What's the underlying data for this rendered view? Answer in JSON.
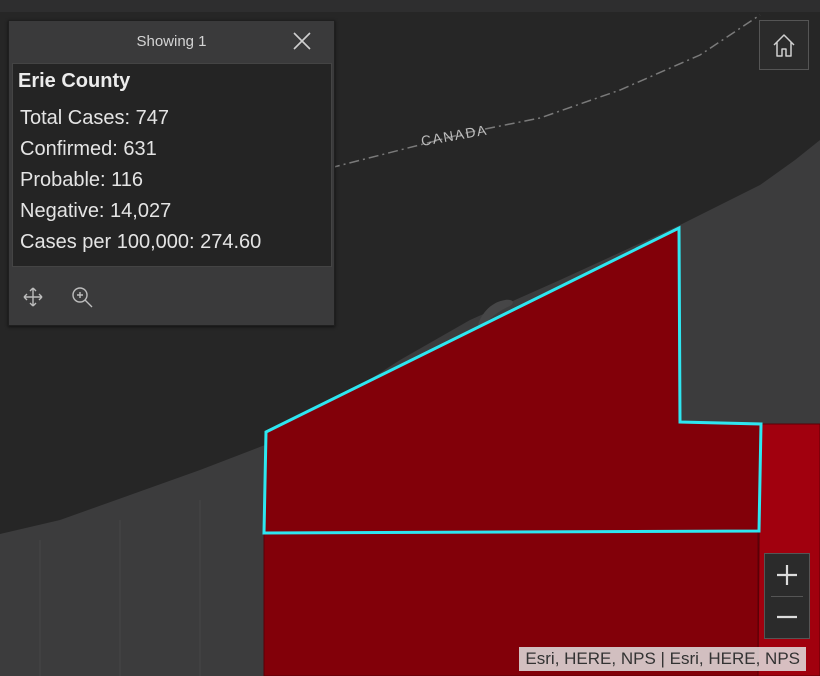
{
  "map": {
    "label_country": "CANADA",
    "colors": {
      "water": "#262626",
      "land": "#3c3c3d",
      "county_fill": "#820009",
      "county_bright": "#a1000e",
      "selection": "#2ee6f0"
    }
  },
  "popup": {
    "feature_count_label": "Showing 1",
    "title": "Erie County",
    "lines": [
      "Total Cases: 747",
      "Confirmed: 631",
      "Probable: 116",
      "Negative: 14,027",
      "Cases per 100,000: 274.60"
    ],
    "icons": [
      "close-icon",
      "pan-icon",
      "zoom-to-icon"
    ]
  },
  "controls": {
    "home_icon": "home-icon",
    "zoom_in_label": "+",
    "zoom_out_label": "−"
  },
  "attribution": "Esri, HERE, NPS | Esri, HERE, NPS"
}
